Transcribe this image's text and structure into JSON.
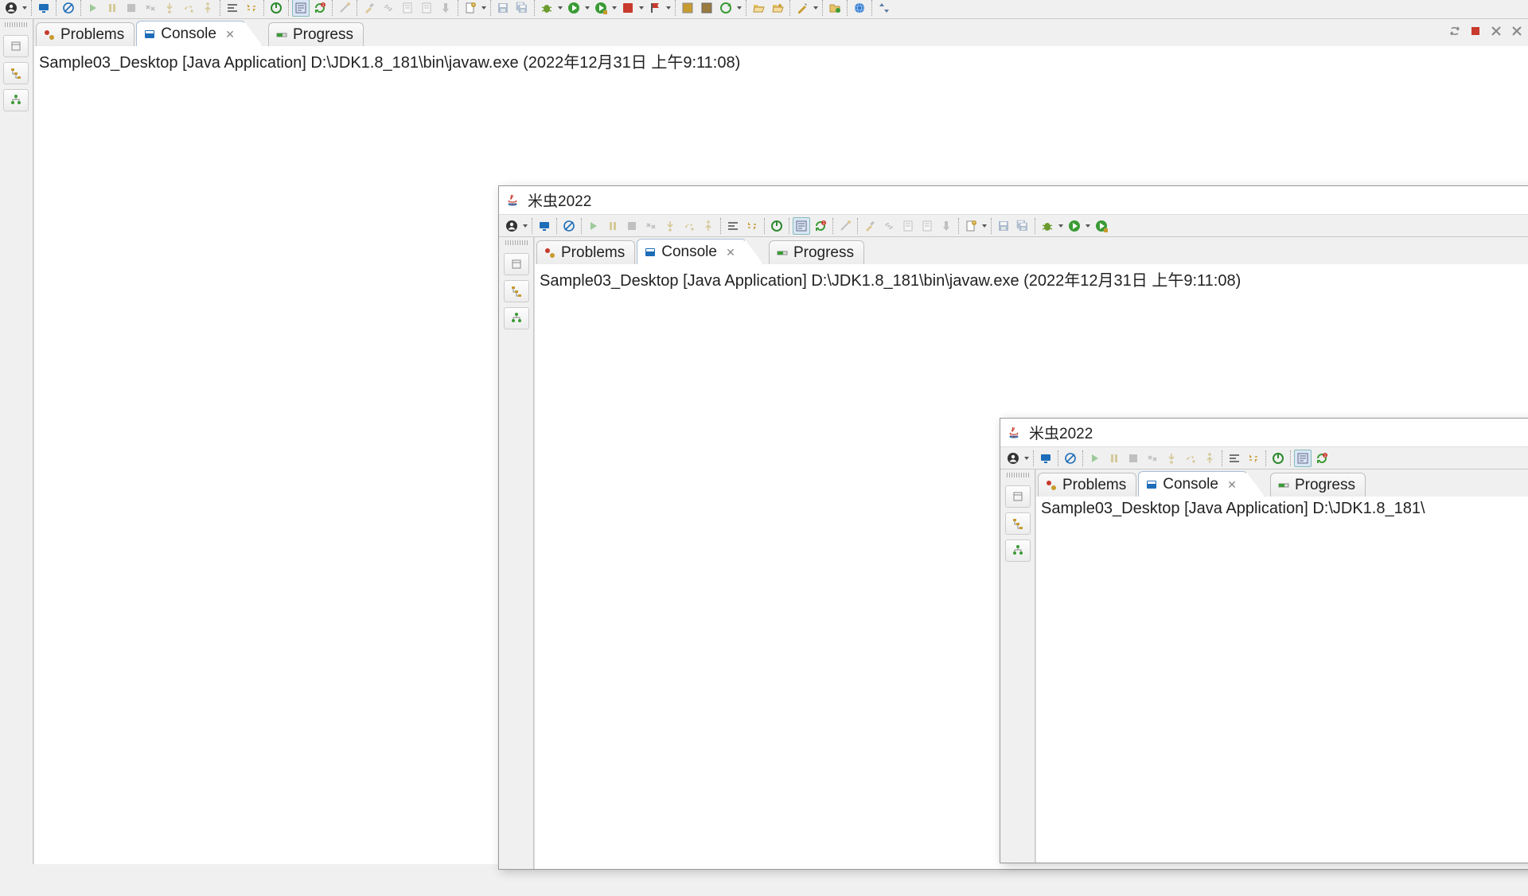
{
  "app_title": "米虫2022",
  "windows": [
    {
      "id": "w1",
      "has_title": false,
      "tabs": [
        {
          "label": "Problems",
          "active": false
        },
        {
          "label": "Console",
          "active": true
        },
        {
          "label": "Progress",
          "active": false
        }
      ],
      "console_line": "Sample03_Desktop [Java Application] D:\\JDK1.8_181\\bin\\javaw.exe (2022年12月31日 上午9:11:08)"
    },
    {
      "id": "w2",
      "has_title": true,
      "tabs": [
        {
          "label": "Problems",
          "active": false
        },
        {
          "label": "Console",
          "active": true
        },
        {
          "label": "Progress",
          "active": false
        }
      ],
      "console_line": "Sample03_Desktop [Java Application] D:\\JDK1.8_181\\bin\\javaw.exe (2022年12月31日 上午9:11:08)"
    },
    {
      "id": "w3",
      "has_title": true,
      "tabs": [
        {
          "label": "Problems",
          "active": false
        },
        {
          "label": "Console",
          "active": true
        },
        {
          "label": "Progress",
          "active": false
        }
      ],
      "console_line": "Sample03_Desktop [Java Application] D:\\JDK1.8_181\\"
    }
  ],
  "colors": {
    "run_green": "#3a9b35",
    "stop_red": "#c73a2d",
    "debug_bug": "#6b9b2f",
    "refresh": "#3a9b35",
    "power_green": "#2f8a2f"
  }
}
